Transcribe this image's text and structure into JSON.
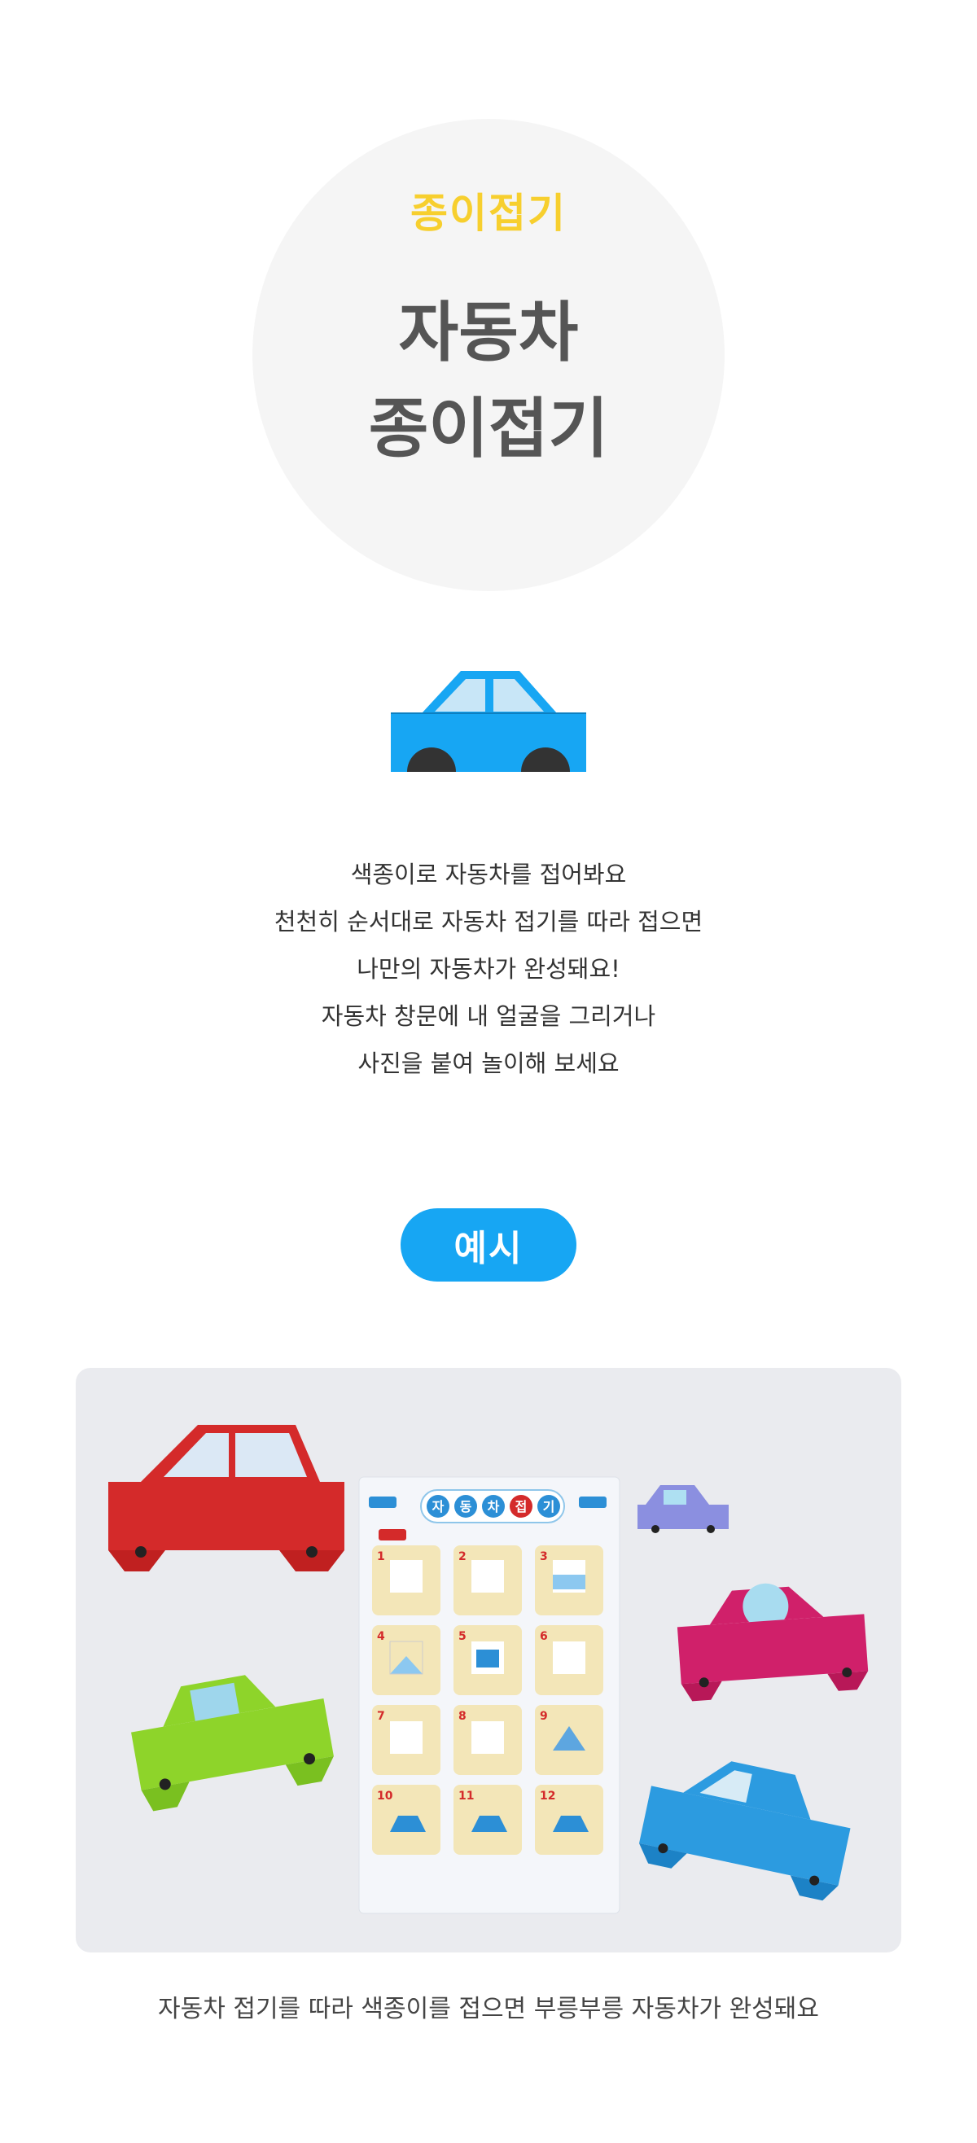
{
  "hero": {
    "label": "종이접기",
    "title_line1": "자동차",
    "title_line2": "종이접기"
  },
  "description": [
    "색종이로 자동차를 접어봐요",
    "천천히 순서대로 자동차 접기를 따라 접으면",
    "나만의 자동차가 완성돼요!",
    "자동차 창문에 내 얼굴을 그리거나",
    "사진을 붙여 놀이해 보세요"
  ],
  "example_label": "예시",
  "sheet": {
    "title_chars": [
      "자",
      "동",
      "차",
      "접",
      "기"
    ],
    "step_numbers": [
      "1",
      "2",
      "3",
      "4",
      "5",
      "6",
      "7",
      "8",
      "9",
      "10",
      "11",
      "12"
    ]
  },
  "caption": "자동차 접기를 따라 색종이를 접으면 부릉부릉 자동차가 완성돼요",
  "colors": {
    "accent_yellow": "#f7cf2e",
    "accent_blue": "#17a6f3",
    "title_gray": "#555555"
  }
}
